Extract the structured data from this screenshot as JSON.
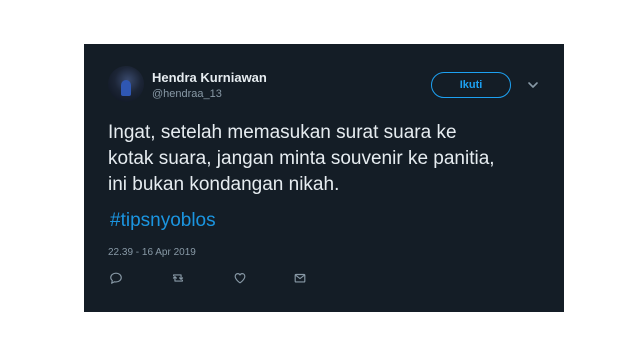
{
  "tweet": {
    "author": {
      "name": "Hendra Kurniawan",
      "handle": "@hendraa_13"
    },
    "follow_label": "Ikuti",
    "text": "Ingat, setelah memasukan surat suara ke\nkotak suara, jangan minta souvenir ke panitia,\nini bukan kondangan nikah.",
    "hashtag": "#tipsnyoblos",
    "timestamp": "22.39 - 16 Apr 2019",
    "actions": [
      "reply-icon",
      "retweet-icon",
      "like-icon",
      "message-icon"
    ]
  },
  "colors": {
    "background": "#141d26",
    "text": "#e6ecf0",
    "muted": "#8899a6",
    "accent": "#1da1f2"
  }
}
